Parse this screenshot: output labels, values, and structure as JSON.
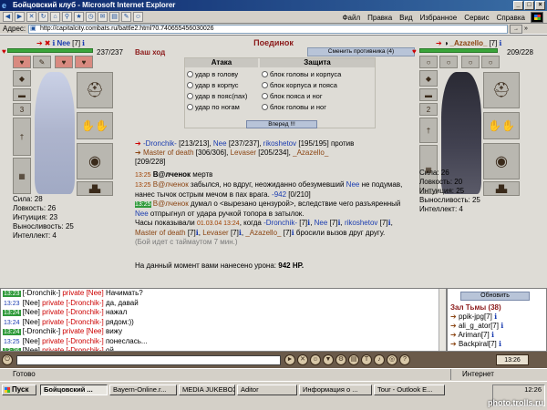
{
  "window": {
    "title": "Бойцовский клуб - Microsoft Internet Explorer",
    "menu": [
      "Файл",
      "Правка",
      "Вид",
      "Избранное",
      "Сервис",
      "Справка"
    ]
  },
  "address": {
    "label": "Адрес:",
    "url": "http://capitalcity.combats.ru/battle2.html?0.740655456030026",
    "go": "→",
    "links": "»"
  },
  "battle": {
    "title": "Поединок",
    "your_move": "Ваш ход",
    "change_opponent": "Сменить противника (4)",
    "attack_header": "Атака",
    "defense_header": "Защита",
    "attacks": [
      "удар в голову",
      "удар в корпус",
      "удар в пояс(пах)",
      "удар по ногам"
    ],
    "defenses": [
      "блок головы и корпуса",
      "блок корпуса и пояса",
      "блок пояса и ног",
      "блок головы и ног"
    ],
    "forward": "Вперед !!!"
  },
  "left_player": {
    "name": "Nee",
    "level": "[7]",
    "hp": "237/237",
    "hp_fraction": 1.0,
    "stats": [
      "Сила: 28",
      "Ловкость: 26",
      "Интуиция: 23",
      "Выносливость: 25",
      "Интеллект: 4"
    ]
  },
  "right_player": {
    "name": "_Azazello_",
    "level": "[7]",
    "hp": "209/228",
    "hp_fraction": 0.917,
    "stats": [
      "Сила: 26",
      "Ловкость: 20",
      "Интуиция: 25",
      "Выносливость: 25",
      "Интеллект: 4"
    ]
  },
  "teams": {
    "line1_a": "-Dronchik-",
    "line1_a_hp": "[213/213],",
    "line1_b": "Nee",
    "line1_b_hp": "[237/237],",
    "line1_c": "rikoshetov",
    "line1_c_hp": "[195/195] против",
    "line2_a": "Master of death",
    "line2_a_hp": "[306/306],",
    "line2_b": "Levaser",
    "line2_b_hp": "[205/234],",
    "line2_c": "_Azazello_",
    "line3": "[209/228]"
  },
  "log": {
    "l1_time": "13:25",
    "l1_name": "B@лченок",
    "l1_text": "мертв",
    "l2_time": "13:25",
    "l2_name": "B@лченок",
    "l2_text": "забылся, но вдруг, неожиданно обезумевший",
    "l2_name2": "Nee",
    "l2_text2": "не подумав, нанес тычок острым мечом в пах врага.",
    "l2_dmg": "-942",
    "l2_rest": "[0/210]",
    "l3_time": "13:25",
    "l3_name": "B@лченок",
    "l3_text": "думал о <вырезано цензурой>, вследствие чего разъяренный",
    "l3_name2": "Nee",
    "l3_text2": "отпрыгнул от удара ручкой топора в затылок.",
    "l4_text": "Часы показывали",
    "l4_date": "01.03.04 13:24",
    "l4_text2": ", когда",
    "l4_a": "-Dronchik-",
    "l4_a_lvl": "[7]",
    "l4_b": "Nee",
    "l4_b_lvl": "[7]",
    "l4_c": "rikoshetov",
    "l4_c_lvl": "[7]",
    "l4_d": "Master of death",
    "l4_d_lvl": "[7]",
    "l4_e": "Levaser",
    "l4_e_lvl": "[7]",
    "l4_f": "_Azazello_",
    "l4_f_lvl": "[7]",
    "l4_end": "бросили вызов друг другу.",
    "l5": "(Бой идет с таймаутом 7 мин.)",
    "damage_text": "На данный момент вами нанесено урона:",
    "damage_value": "942 HP."
  },
  "chat": [
    {
      "time": "13:23",
      "from": "[-Dronchik-]",
      "to": "private [Nee]",
      "text": "Начимать?"
    },
    {
      "time": "13:23",
      "from": "[Nee]",
      "to": "private [-Dronchik-]",
      "text": "да, давай"
    },
    {
      "time": "13:24",
      "from": "[Nee]",
      "to": "private [-Dronchik-]",
      "text": "нажал"
    },
    {
      "time": "13:24",
      "from": "[Nee]",
      "to": "private [-Dronchik-]",
      "text": "рядом:))"
    },
    {
      "time": "13:24",
      "from": "[-Dronchik-]",
      "to": "private [Nee]",
      "text": "вижу"
    },
    {
      "time": "13:25",
      "from": "[Nee]",
      "to": "private [-Dronchik-]",
      "text": "понеслась..."
    },
    {
      "time": "13:26",
      "from": "[Nee]",
      "to": "private [-Dronchik-]",
      "text": "ой"
    }
  ],
  "room": {
    "refresh": "Обновить",
    "title": "Зал Тьмы (38)",
    "members": [
      "ppik-jpg[7]",
      "ali_g_ator[7]",
      "Ariman[7]",
      "Backpiral[7]"
    ]
  },
  "clock": "13:26",
  "status": {
    "left": "Готово",
    "zone": "Интернет"
  },
  "taskbar": {
    "start": "Пуск",
    "tasks": [
      "Бойцовский ...",
      "Bayern-Online.r...",
      "MEDIA JUKEBOX",
      "Aditor",
      "Информация о ...",
      "Tour - Outlook E..."
    ],
    "time": "12:26",
    "watermark": "photo.trolls.ru"
  }
}
